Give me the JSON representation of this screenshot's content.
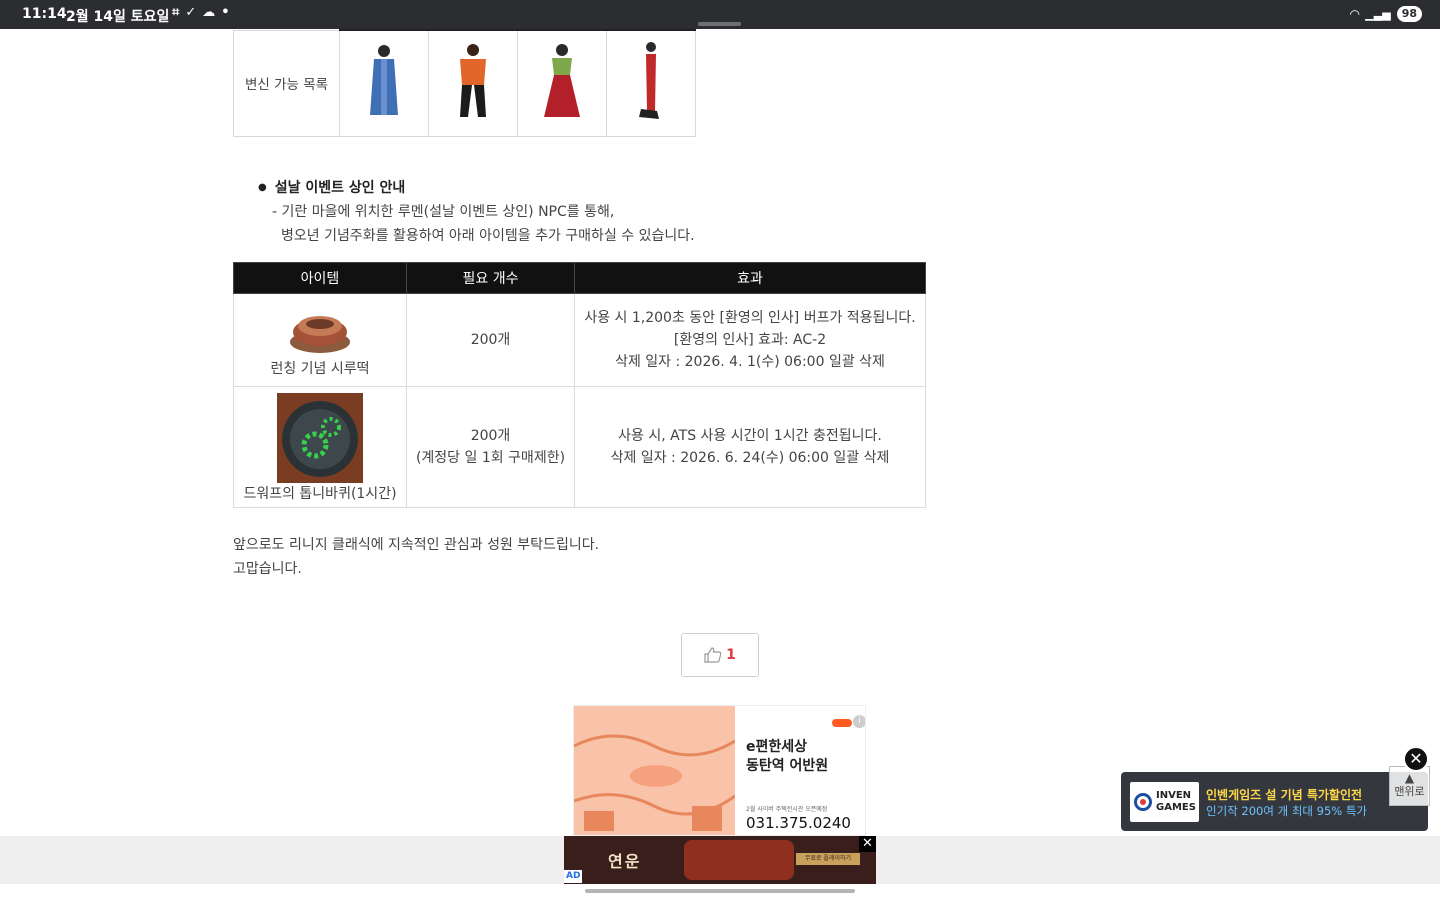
{
  "status": {
    "time": "11:14",
    "date": "2월 14일 토요일",
    "battery": "98"
  },
  "morph_table": {
    "label": "변신 가능 목록",
    "figures": [
      {
        "name": "blue-robe-figure",
        "color": "#3f6fb5"
      },
      {
        "name": "orange-black-figure",
        "color": "#e0662a"
      },
      {
        "name": "hanbok-green-red-figure",
        "color": "#b3202a"
      },
      {
        "name": "red-dress-figure",
        "color": "#c02a2a"
      }
    ]
  },
  "notice": {
    "title": "설날 이벤트 상인 안내",
    "line1": "- 기란 마을에 위치한 루멘(설날 이벤트 상인) NPC를 통해,",
    "line2": "병오년 기념주화를 활용하여 아래 아이템을 추가 구매하실 수 있습니다."
  },
  "items_table": {
    "headers": [
      "아이템",
      "필요 개수",
      "효과"
    ],
    "rows": [
      {
        "item_name": "런칭 기념 시루떡",
        "count": "200개",
        "effect_lines": [
          "사용 시 1,200초 동안 [환영의 인사] 버프가 적용됩니다.",
          "[환영의 인사] 효과: AC-2",
          "삭제 일자 : 2026. 4. 1(수) 06:00 일괄 삭제"
        ]
      },
      {
        "item_name": "드워프의 톱니바퀴(1시간)",
        "count": "200개",
        "count_note": "(계정당 일 1회 구매제한)",
        "effect_lines": [
          "사용 시, ATS 사용 시간이 1시간 충전됩니다.",
          "삭제 일자 : 2026. 6. 24(수) 06:00 일괄 삭제"
        ]
      }
    ]
  },
  "closing": {
    "line1": "앞으로도 리니지 클래식에 지속적인 관심과 성원 부탁드립니다.",
    "line2": "고맙습니다."
  },
  "like": {
    "count": "1"
  },
  "ad": {
    "title_line1": "e편한세상",
    "title_line2": "동탄역 어반원",
    "fine_print": "2월 사이버 주택전시관 오픈예정",
    "phone": "031.375.0240"
  },
  "bottom_banner": {
    "title": "연운",
    "cta": "무료로 플레이하기",
    "ad_tag": "AD",
    "close": "✕"
  },
  "popup": {
    "logo_line1": "INVEN",
    "logo_line2": "GAMES",
    "line1": "인벤게임즈 설 기념 특가할인전",
    "line2": "인기작 200여 개 최대 95% 특가",
    "close": "✕",
    "to_top": "맨위로"
  }
}
